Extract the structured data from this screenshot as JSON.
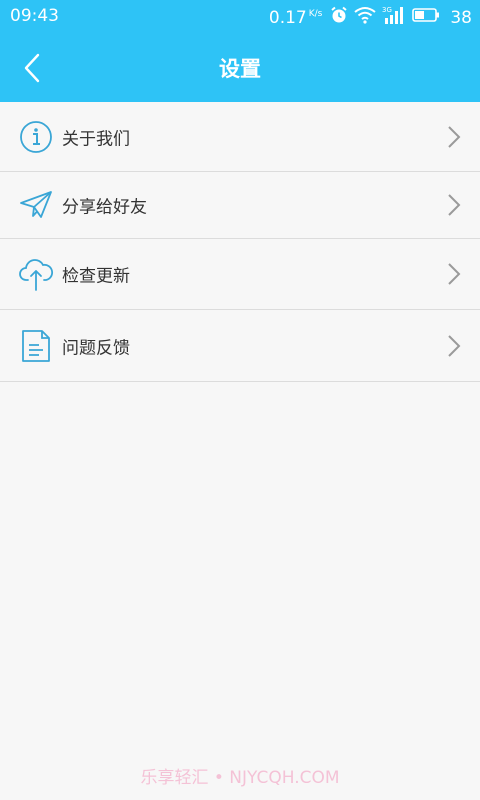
{
  "status_bar": {
    "time": "09:43",
    "speed": "0.17",
    "speed_unit": "K/s",
    "network": "3G",
    "battery_level": "38"
  },
  "header": {
    "title": "设置",
    "background_color": "#2ec3f6"
  },
  "menu": {
    "items": [
      {
        "label": "关于我们",
        "icon": "info-icon"
      },
      {
        "label": "分享给好友",
        "icon": "paper-plane-icon"
      },
      {
        "label": "检查更新",
        "icon": "cloud-upload-icon"
      },
      {
        "label": "问题反馈",
        "icon": "document-icon"
      }
    ]
  },
  "watermark": "乐享轻汇 • NJYCQH.COM",
  "colors": {
    "accent": "#2ec3f6",
    "icon": "#3aa6d6",
    "chevron": "#9a9a9a"
  }
}
